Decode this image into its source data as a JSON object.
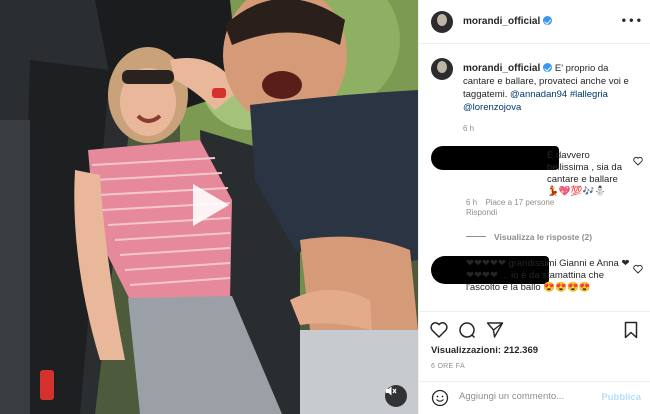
{
  "post": {
    "username": "morandi_official",
    "verified": true,
    "caption_text": "E' proprio da cantare e ballare, provateci anche voi e taggatemi.",
    "caption_tags": "@annadan94 #lallegria @lorenzojova",
    "caption_time": "6 h",
    "views_label": "Visualizzazioni:",
    "views_count": "212.369",
    "posted_ago": "6 ORE FA"
  },
  "comments": [
    {
      "text": "È davvero bellissima , sia da cantare e ballare 💃💖💯🎶⛄",
      "time": "6 h",
      "likes": "Piace a 17 persone",
      "reply": "Rispondi",
      "view_replies": "Visualizza le risposte (2)"
    },
    {
      "text": "❤❤❤❤❤ grandissimi Gianni e Anna ❤❤❤❤❤ ... io è da stamattina che l'ascolto e la ballo 😍😍😍😍"
    }
  ],
  "add_comment": {
    "placeholder": "Aggiungi un commento...",
    "publish_label": "Pubblica"
  },
  "icons": {
    "more": "more-options-icon",
    "like": "heart-icon",
    "comment": "comment-icon",
    "share": "send-icon",
    "save": "bookmark-icon",
    "emoji": "emoji-icon",
    "play": "play-icon",
    "mute": "speaker-muted-icon"
  },
  "colors": {
    "accent": "#3897f0",
    "link": "#00376b",
    "muted": "#8e8e8e",
    "publish_disabled": "#b2dffc"
  }
}
